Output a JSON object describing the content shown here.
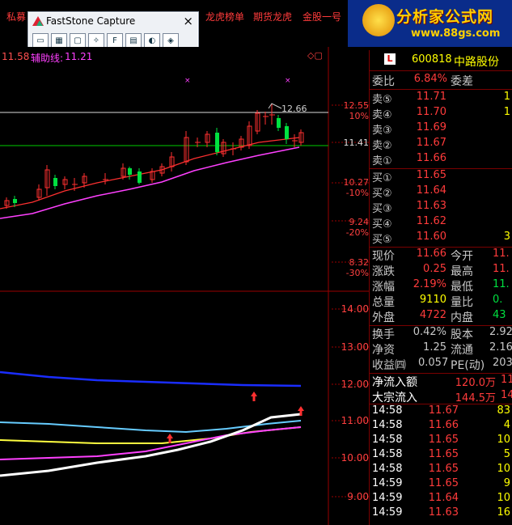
{
  "menu": [
    "私募",
    "龙虎榜单",
    "期货龙虎",
    "金股一号"
  ],
  "faststone": {
    "title": "FastStone Capture",
    "close": "×",
    "tools": [
      "▭",
      "▦",
      "▢",
      "✧",
      "F",
      "▤",
      "◐",
      "◈"
    ]
  },
  "logo": {
    "text": "分析家公式网",
    "url": "www.88gs.com"
  },
  "indicator": {
    "price": "11.58",
    "aux_label": "辅助线:",
    "aux_value": "11.21"
  },
  "upper_axis": [
    {
      "price": "12.55",
      "pct": "10%"
    },
    {
      "price": "11.41",
      "pct": ""
    },
    {
      "price": "10.27",
      "pct": "-10%"
    },
    {
      "price": "9.24",
      "pct": "-20%"
    },
    {
      "price": "8.32",
      "pct": "-30%"
    }
  ],
  "high_label": "12.66",
  "lower_axis": [
    "14.00",
    "13.00",
    "12.00",
    "11.00",
    "10.00",
    "9.00"
  ],
  "stock": {
    "badge": "L",
    "code": "600818",
    "name": "中路股份"
  },
  "weibi": {
    "label": "委比",
    "value": "6.84%",
    "label2": "委差",
    "value2": ""
  },
  "sell": [
    {
      "label": "卖⑤",
      "price": "11.71",
      "vol": "1"
    },
    {
      "label": "卖④",
      "price": "11.70",
      "vol": "1"
    },
    {
      "label": "卖③",
      "price": "11.69",
      "vol": ""
    },
    {
      "label": "卖②",
      "price": "11.67",
      "vol": ""
    },
    {
      "label": "卖①",
      "price": "11.66",
      "vol": ""
    }
  ],
  "buy": [
    {
      "label": "买①",
      "price": "11.65",
      "vol": ""
    },
    {
      "label": "买②",
      "price": "11.64",
      "vol": ""
    },
    {
      "label": "买③",
      "price": "11.63",
      "vol": ""
    },
    {
      "label": "买④",
      "price": "11.62",
      "vol": ""
    },
    {
      "label": "买⑤",
      "price": "11.60",
      "vol": "3"
    }
  ],
  "quote": [
    {
      "l1": "现价",
      "v1": "11.66",
      "l2": "今开",
      "v2": "11."
    },
    {
      "l1": "涨跌",
      "v1": "0.25",
      "l2": "最高",
      "v2": "11."
    },
    {
      "l1": "涨幅",
      "v1": "2.19%",
      "l2": "最低",
      "v2": "11."
    },
    {
      "l1": "总量",
      "v1": "9110",
      "l2": "量比",
      "v2": "0."
    },
    {
      "l1": "外盘",
      "v1": "4722",
      "l2": "内盘",
      "v2": "43"
    }
  ],
  "fund": [
    {
      "l1": "换手",
      "v1": "0.42%",
      "l2": "股本",
      "v2": "2.92"
    },
    {
      "l1": "净资",
      "v1": "1.25",
      "l2": "流通",
      "v2": "2.16"
    },
    {
      "l1": "收益㈣",
      "v1": "0.057",
      "l2": "PE(动)",
      "v2": "203"
    }
  ],
  "flow": [
    {
      "label": "净流入额",
      "value": "120.0万",
      "extra": "11"
    },
    {
      "label": "大宗流入",
      "value": "144.5万",
      "extra": "14"
    }
  ],
  "ticks": [
    {
      "time": "14:58",
      "price": "11.67",
      "vol": "83"
    },
    {
      "time": "14:58",
      "price": "11.66",
      "vol": "4"
    },
    {
      "time": "14:58",
      "price": "11.65",
      "vol": "10"
    },
    {
      "time": "14:58",
      "price": "11.65",
      "vol": "5"
    },
    {
      "time": "14:58",
      "price": "11.65",
      "vol": "10"
    },
    {
      "time": "14:59",
      "price": "11.65",
      "vol": "9"
    },
    {
      "time": "14:59",
      "price": "11.64",
      "vol": "10"
    },
    {
      "time": "14:59",
      "price": "11.63",
      "vol": "16"
    }
  ],
  "colors": {
    "up": "#ff3b3b",
    "down": "#00e040",
    "price": "#ffff00",
    "label": "#c8c8c8"
  }
}
